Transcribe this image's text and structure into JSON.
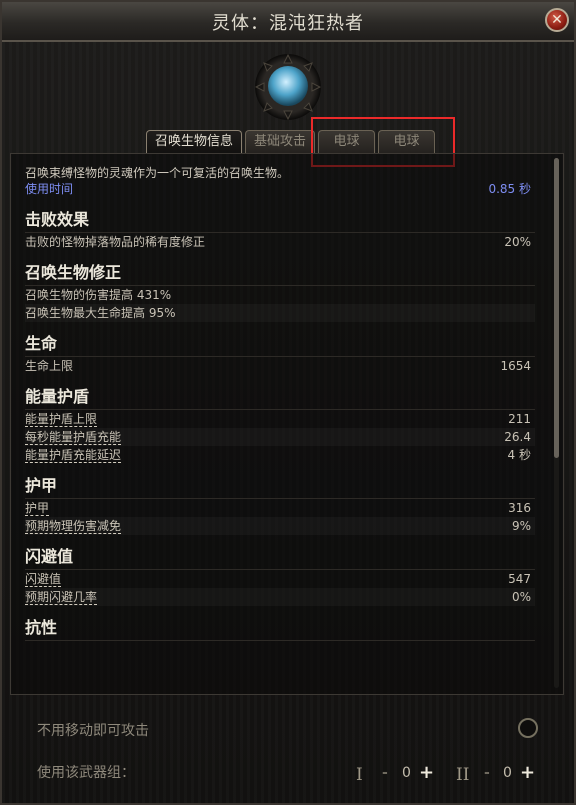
{
  "window": {
    "title": "灵体：混沌狂热者"
  },
  "tabs": [
    {
      "label": "召唤生物信息",
      "active": true
    },
    {
      "label": "基础攻击",
      "active": false
    },
    {
      "label": "电球",
      "active": false
    },
    {
      "label": "电球",
      "active": false
    }
  ],
  "description": "召唤束缚怪物的灵魂作为一个可复活的召唤生物。",
  "use_time": {
    "label": "使用时间",
    "value": "0.85 秒"
  },
  "sections": {
    "defeat": {
      "title": "击败效果",
      "rows": [
        {
          "label": "击败的怪物掉落物品的稀有度修正",
          "value": "20%"
        }
      ]
    },
    "minion_mod": {
      "title": "召唤生物修正",
      "rows": [
        {
          "label": "召唤生物的伤害提高 431%",
          "value": ""
        },
        {
          "label": "召唤生物最大生命提高 95%",
          "value": ""
        }
      ]
    },
    "life": {
      "title": "生命",
      "rows": [
        {
          "label": "生命上限",
          "value": "1654"
        }
      ]
    },
    "es": {
      "title": "能量护盾",
      "rows": [
        {
          "label": "能量护盾上限",
          "value": "211"
        },
        {
          "label": "每秒能量护盾充能",
          "value": "26.4"
        },
        {
          "label": "能量护盾充能延迟",
          "value": "4 秒"
        }
      ]
    },
    "armour": {
      "title": "护甲",
      "rows": [
        {
          "label": "护甲",
          "value": "316"
        },
        {
          "label": "预期物理伤害减免",
          "value": "9%"
        }
      ]
    },
    "evasion": {
      "title": "闪避值",
      "rows": [
        {
          "label": "闪避值",
          "value": "547"
        },
        {
          "label": "预期闪避几率",
          "value": "0%"
        }
      ]
    },
    "resist": {
      "title": "抗性"
    }
  },
  "footer": {
    "attack_without_moving": "不用移动即可攻击",
    "use_weapon_set": "使用该武器组：",
    "set1": {
      "roman": "I",
      "minus": "-",
      "value": "0",
      "plus": "+"
    },
    "set2": {
      "roman": "II",
      "minus": "-",
      "value": "0",
      "plus": "+"
    }
  },
  "colors": {
    "highlight": "#ec2a2a",
    "blue_text": "#7d8df2"
  },
  "icons": {
    "close": "close-icon",
    "emblem": "minion-portrait-icon"
  }
}
